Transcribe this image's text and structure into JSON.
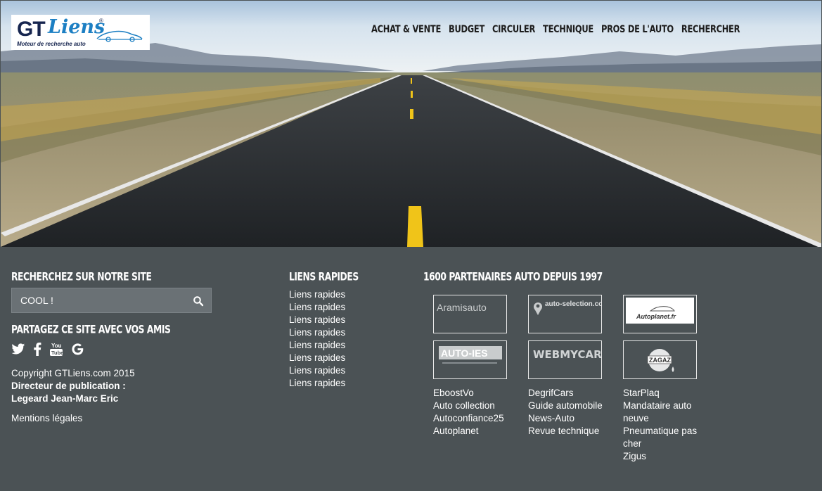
{
  "logo": {
    "brand_gt": "GT",
    "brand_liens": "Liens",
    "reg": "®",
    "tagline": "Moteur de recherche auto"
  },
  "nav": [
    "ACHAT & VENTE",
    "BUDGET",
    "CIRCULER",
    "TECHNIQUE",
    "PROS DE L'AUTO",
    "RECHERCHER"
  ],
  "search": {
    "title": "RECHERCHEZ SUR NOTRE SITE",
    "value": "COOL !",
    "icon": "search-icon"
  },
  "share": {
    "title": "PARTAGEZ CE SITE AVEC VOS AMIS",
    "icons": [
      "twitter-icon",
      "facebook-icon",
      "youtube-icon",
      "google-icon"
    ]
  },
  "copyright": {
    "line1": "Copyright GTLiens.com 2015",
    "line2": "Directeur de publication :",
    "line3": "Legeard Jean-Marc Eric",
    "legal": "Mentions légales"
  },
  "quick_links": {
    "title": "LIENS RAPIDES",
    "items": [
      "Liens rapides",
      "Liens rapides",
      "Liens rapides",
      "Liens rapides",
      "Liens rapides",
      "Liens rapides",
      "Liens rapides",
      "Liens rapides"
    ]
  },
  "partners": {
    "title": "1600 PARTENAIRES AUTO DEPUIS 1997",
    "logos": [
      "Aramisauto",
      "auto-selection.com",
      "Autoplanet.fr",
      "AUTO-IES",
      "WEBMYCAR",
      "ZAGAZ"
    ],
    "col1": [
      "EboostVo",
      "Auto collection",
      "Autoconfiance25",
      "Autoplanet"
    ],
    "col2": [
      "DegrifCars",
      "Guide automobile",
      "News-Auto",
      "Revue technique"
    ],
    "col3": [
      "StarPlaq",
      "Mandataire auto",
      "neuve",
      "Pneumatique pas",
      "cher",
      "Zigus"
    ]
  },
  "colors": {
    "footer_bg": "#4b5255",
    "logo_blue": "#1c7fc3",
    "logo_navy": "#16254f",
    "road_line": "#f0c419"
  }
}
